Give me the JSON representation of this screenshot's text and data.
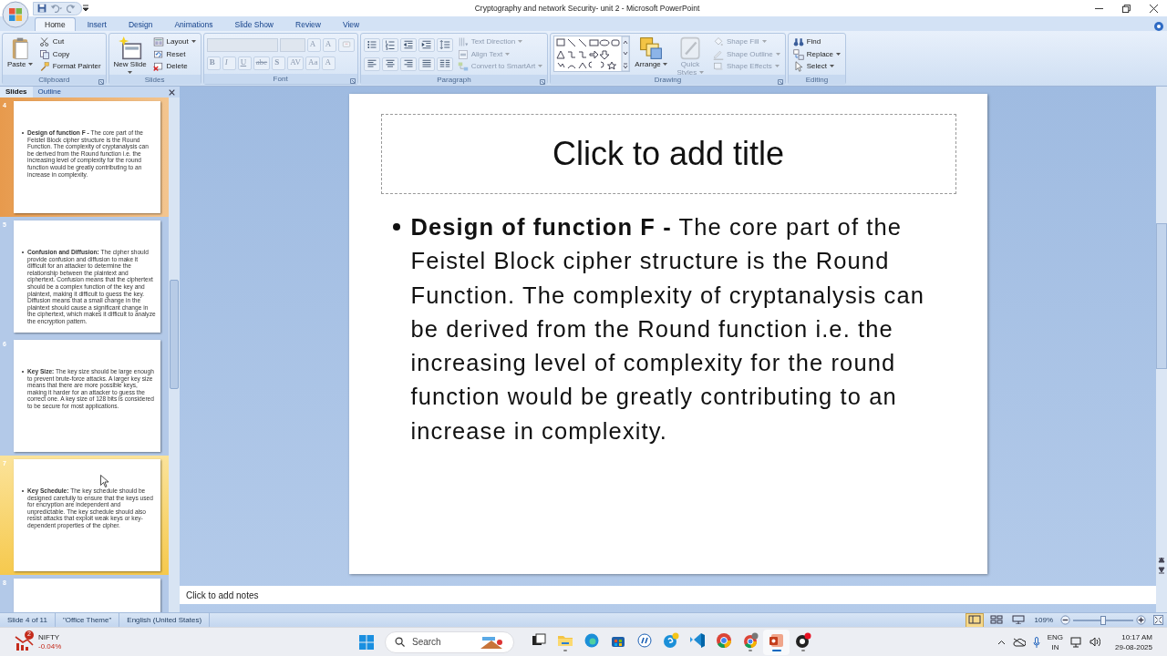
{
  "window": {
    "title": "Cryptography and network Security- unit 2 - Microsoft PowerPoint"
  },
  "ribbon_tabs": [
    {
      "label": "Home",
      "selected": true
    },
    {
      "label": "Insert",
      "selected": false
    },
    {
      "label": "Design",
      "selected": false
    },
    {
      "label": "Animations",
      "selected": false
    },
    {
      "label": "Slide Show",
      "selected": false
    },
    {
      "label": "Review",
      "selected": false
    },
    {
      "label": "View",
      "selected": false
    }
  ],
  "ribbon_groups": [
    {
      "label": "Clipboard",
      "launcher": true,
      "columns": [
        [
          {
            "kind": "large",
            "label": "Paste",
            "dropdown": true,
            "disabled": false
          }
        ],
        [
          {
            "kind": "small",
            "label": "Cut",
            "dropdown": false,
            "disabled": false
          },
          {
            "kind": "small",
            "label": "Copy",
            "dropdown": false,
            "disabled": false
          },
          {
            "kind": "small",
            "label": "Format Painter",
            "dropdown": false,
            "disabled": false
          }
        ]
      ]
    },
    {
      "label": "Slides",
      "launcher": false,
      "columns": [
        [
          {
            "kind": "large",
            "label": "New Slide",
            "dropdown": true,
            "disabled": false
          }
        ],
        [
          {
            "kind": "small",
            "label": "Layout",
            "dropdown": true,
            "disabled": false
          },
          {
            "kind": "small",
            "label": "Reset",
            "dropdown": false,
            "disabled": false
          },
          {
            "kind": "small",
            "label": "Delete",
            "dropdown": false,
            "disabled": false
          }
        ]
      ]
    },
    {
      "label": "Font",
      "launcher": true,
      "columns": [
        [
          {
            "kind": "row",
            "buttons": [
              {
                "kind": "field",
                "disabled": true
              },
              {
                "kind": "field",
                "disabled": true
              },
              {
                "kind": "glyph",
                "label": "A",
                "disabled": true
              },
              {
                "kind": "glyph",
                "label": "A",
                "disabled": true
              },
              {
                "kind": "icon",
                "disabled": true
              }
            ]
          },
          {
            "kind": "row",
            "buttons": [
              {
                "kind": "glyph",
                "label": "B",
                "disabled": true
              },
              {
                "kind": "glyph",
                "label": "I",
                "disabled": true
              },
              {
                "kind": "glyph",
                "label": "U",
                "disabled": true
              },
              {
                "kind": "glyph",
                "label": "abe",
                "disabled": true
              },
              {
                "kind": "glyph",
                "label": "S",
                "disabled": true
              },
              {
                "kind": "glyph",
                "label": "AV",
                "disabled": true
              },
              {
                "kind": "glyph",
                "label": "Aa",
                "disabled": true
              },
              {
                "kind": "glyph",
                "label": "A",
                "disabled": true
              }
            ]
          }
        ]
      ]
    },
    {
      "label": "Paragraph",
      "launcher": true,
      "columns": [
        [
          {
            "kind": "row",
            "buttons": [
              {
                "kind": "icon",
                "disabled": false
              },
              {
                "kind": "icon",
                "disabled": false
              },
              {
                "kind": "icon",
                "disabled": false
              },
              {
                "kind": "icon",
                "disabled": false
              },
              {
                "kind": "icon",
                "disabled": false
              }
            ]
          },
          {
            "kind": "row",
            "buttons": [
              {
                "kind": "icon",
                "disabled": false
              },
              {
                "kind": "icon",
                "disabled": false
              },
              {
                "kind": "icon",
                "disabled": false
              },
              {
                "kind": "icon",
                "disabled": false
              },
              {
                "kind": "icon",
                "disabled": false
              }
            ]
          }
        ],
        [
          {
            "kind": "small",
            "label": "Text Direction",
            "dropdown": true,
            "disabled": true
          },
          {
            "kind": "small",
            "label": "Align Text",
            "dropdown": true,
            "disabled": true
          },
          {
            "kind": "small",
            "label": "Convert to SmartArt",
            "dropdown": true,
            "disabled": true
          }
        ]
      ]
    },
    {
      "label": "Drawing",
      "launcher": true,
      "columns": [
        [
          {
            "kind": "gallery"
          }
        ],
        [
          {
            "kind": "large",
            "label": "Arrange",
            "dropdown": true,
            "disabled": false
          }
        ],
        [
          {
            "kind": "large",
            "label": "Quick Styles",
            "dropdown": true,
            "disabled": true
          }
        ],
        [
          {
            "kind": "small",
            "label": "Shape Fill",
            "dropdown": true,
            "disabled": true
          },
          {
            "kind": "small",
            "label": "Shape Outline",
            "dropdown": true,
            "disabled": true
          },
          {
            "kind": "small",
            "label": "Shape Effects",
            "dropdown": true,
            "disabled": true
          }
        ]
      ]
    },
    {
      "label": "Editing",
      "launcher": false,
      "columns": [
        [
          {
            "kind": "small",
            "label": "Find",
            "dropdown": false,
            "disabled": false
          },
          {
            "kind": "small",
            "label": "Replace",
            "dropdown": true,
            "disabled": false
          },
          {
            "kind": "small",
            "label": "Select",
            "dropdown": true,
            "disabled": false
          }
        ]
      ]
    }
  ],
  "slide_panel": {
    "tabs": [
      {
        "label": "Slides",
        "selected": true
      },
      {
        "label": "Outline",
        "selected": false
      }
    ],
    "thumbnails": [
      {
        "number": "4",
        "selected": true,
        "hovered": false,
        "text": "**Design of function F -** The core part of the Feistel Block cipher structure is the Round Function. The complexity of cryptanalysis can be derived from the Round function i.e. the increasing level of complexity for the round function would be greatly contributing to an increase in complexity."
      },
      {
        "number": "5",
        "selected": false,
        "hovered": false,
        "text": "**Confusion and Diffusion:** The cipher should provide confusion and diffusion to make it difficult for an attacker to determine the relationship between the plaintext and ciphertext. Confusion means that the ciphertext should be a complex function of the key and plaintext, making it difficult to guess the key. Diffusion means that a small change in the plaintext should cause a significant change in the ciphertext, which makes it difficult to analyze the encryption pattern."
      },
      {
        "number": "6",
        "selected": false,
        "hovered": false,
        "text": "**Key Size:** The key size should be large enough to prevent brute-force attacks. A larger key size means that there are more possible keys, making it harder for an attacker to guess the correct one. A key size of 128 bits is considered to be secure for most applications."
      },
      {
        "number": "7",
        "selected": false,
        "hovered": true,
        "text": "**Key Schedule:** The key schedule should be designed carefully to ensure that the keys used for encryption are independent and unpredictable. The key schedule should also resist attacks that exploit weak keys or key-dependent properties of the cipher."
      },
      {
        "number": "8",
        "selected": false,
        "hovered": false
      }
    ]
  },
  "slide": {
    "title_placeholder": "Click to add title",
    "bullets": [
      "**Design of function F -** The core part of the Feistel Block cipher structure is the Round Function. The complexity of cryptanalysis can be derived from the Round function i.e. the increasing level of complexity for the round function would be greatly contributing to an increase in complexity."
    ]
  },
  "notes": {
    "placeholder": "Click to add notes"
  },
  "status_bar": {
    "items": [
      "Slide 4 of 11",
      "\"Office Theme\"",
      "English (United States)"
    ],
    "views": [
      {
        "selected": true
      },
      {
        "selected": false
      },
      {
        "selected": false
      }
    ],
    "zoom": {
      "reading": "109%",
      "level": 0.5
    }
  },
  "taskbar": {
    "widget": {
      "title": "NIFTY",
      "change": "-0.04%",
      "badge": "2"
    },
    "search": {
      "label": "Search"
    },
    "apps": [
      {
        "running": false,
        "active": false
      },
      {
        "running": true,
        "active": false
      },
      {
        "running": false,
        "active": false
      },
      {
        "running": false,
        "active": false
      },
      {
        "running": false,
        "active": false
      },
      {
        "running": false,
        "active": false
      },
      {
        "running": false,
        "active": false
      },
      {
        "running": false,
        "active": false
      },
      {
        "running": true,
        "active": false
      },
      {
        "running": true,
        "active": true
      },
      {
        "running": true,
        "active": false
      }
    ],
    "tray": {
      "language": "ENG",
      "region": "IN",
      "time": "10:17 AM",
      "date": "29-08-2025"
    }
  }
}
